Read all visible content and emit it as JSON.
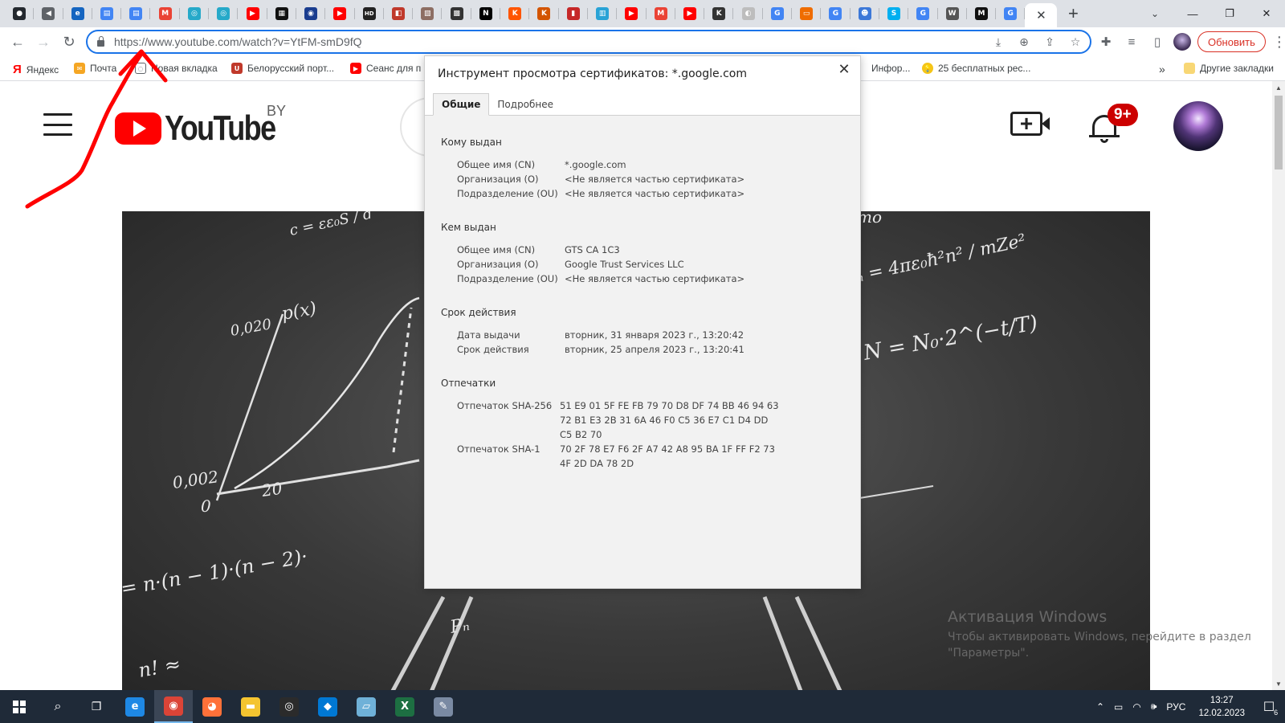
{
  "browser": {
    "tab_favicons": [
      {
        "name": "github-icon",
        "glyph": "●",
        "bg": "#24292f"
      },
      {
        "name": "audio-muted-icon",
        "glyph": "◀",
        "bg": "#5f6368"
      },
      {
        "name": "edge-icon",
        "glyph": "e",
        "bg": "#1565c0"
      },
      {
        "name": "docs-icon",
        "glyph": "▤",
        "bg": "#4285f4"
      },
      {
        "name": "docs-icon",
        "glyph": "▤",
        "bg": "#4285f4"
      },
      {
        "name": "gmail-icon",
        "glyph": "M",
        "bg": "#ea4335"
      },
      {
        "name": "circle-app-icon",
        "glyph": "◎",
        "bg": "#26a9c9"
      },
      {
        "name": "circle-app-icon",
        "glyph": "◎",
        "bg": "#26a9c9"
      },
      {
        "name": "youtube-icon",
        "glyph": "▶",
        "bg": "#ff0000"
      },
      {
        "name": "film-icon",
        "glyph": "▦",
        "bg": "#111111"
      },
      {
        "name": "eye-icon",
        "glyph": "◉",
        "bg": "#1a3d8f"
      },
      {
        "name": "youtube-icon",
        "glyph": "▶",
        "bg": "#ff0000"
      },
      {
        "name": "hd-icon",
        "glyph": "HD",
        "bg": "#222222"
      },
      {
        "name": "bookmark-app-icon",
        "glyph": "◧",
        "bg": "#c0392b"
      },
      {
        "name": "notes-icon",
        "glyph": "▧",
        "bg": "#8d6e63"
      },
      {
        "name": "grid-app-icon",
        "glyph": "▩",
        "bg": "#333333"
      },
      {
        "name": "notion-icon",
        "glyph": "N",
        "bg": "#000000"
      },
      {
        "name": "kinopoisk-icon",
        "glyph": "K",
        "bg": "#ff5500"
      },
      {
        "name": "ki-app-icon",
        "glyph": "K",
        "bg": "#d35400"
      },
      {
        "name": "red-book-icon",
        "glyph": "▮",
        "bg": "#c62828"
      },
      {
        "name": "book-icon",
        "glyph": "▥",
        "bg": "#29a3d6"
      },
      {
        "name": "youtube-icon",
        "glyph": "▶",
        "bg": "#ff0000"
      },
      {
        "name": "gmail-icon",
        "glyph": "M",
        "bg": "#ea4335"
      },
      {
        "name": "youtube-icon",
        "glyph": "▶",
        "bg": "#ff0000"
      },
      {
        "name": "k-app-icon",
        "glyph": "K",
        "bg": "#333333"
      },
      {
        "name": "search-app-icon",
        "glyph": "◐",
        "bg": "#bdbdbd"
      },
      {
        "name": "google-icon",
        "glyph": "G",
        "bg": "#4285f4"
      },
      {
        "name": "web-page-icon",
        "glyph": "▭",
        "bg": "#ef6c00"
      },
      {
        "name": "google-icon",
        "glyph": "G",
        "bg": "#4285f4"
      },
      {
        "name": "reddit-icon",
        "glyph": "☻",
        "bg": "#3c78d8"
      },
      {
        "name": "skype-icon",
        "glyph": "S",
        "bg": "#00aff0"
      },
      {
        "name": "google-icon",
        "glyph": "G",
        "bg": "#4285f4"
      },
      {
        "name": "wikipedia-icon",
        "glyph": "W",
        "bg": "#555555"
      },
      {
        "name": "m-app-icon",
        "glyph": "M",
        "bg": "#111111"
      },
      {
        "name": "google-icon",
        "glyph": "G",
        "bg": "#4285f4"
      }
    ],
    "active_tab_close": "✕",
    "new_tab": "+",
    "url_domain": "https://www.youtube.com",
    "url_path": "/watch?v=YtFM-smD9fQ",
    "update_label": "Обновить"
  },
  "bookmarks": {
    "items": [
      {
        "label": "Яндекс"
      },
      {
        "label": "Почта"
      },
      {
        "label": "Новая вкладка"
      },
      {
        "label": "Белорусский порт..."
      },
      {
        "label": "Сеанс для п"
      },
      {
        "label": "Инфор..."
      },
      {
        "label": "25 бесплатных рес..."
      }
    ],
    "more": "»",
    "other_bookmarks": "Другие закладки"
  },
  "youtube": {
    "logo_text": "YouTube",
    "region": "BY",
    "notification_count": "9+"
  },
  "chalkboard": {
    "formulas": [
      "c = εε₀S / d",
      "0,020",
      "p(x)",
      "0,002",
      "20",
      "0",
      "= n·(n − 1)·(n − 2)·",
      "n! ≈",
      "rₙ = 4πε₀ħ²n² / mZe²",
      "N = N₀·2^(−t/T)",
      "Pₙ",
      "mo"
    ]
  },
  "certificate": {
    "title": "Инструмент просмотра сертификатов: *.google.com",
    "close": "✕",
    "tabs": [
      {
        "label": "Общие",
        "active": true
      },
      {
        "label": "Подробнее",
        "active": false
      }
    ],
    "issued_to": {
      "heading": "Кому выдан",
      "rows": [
        {
          "key": "Общее имя (CN)",
          "value": "*.google.com"
        },
        {
          "key": "Организация (O)",
          "value": "<Не является частью сертификата>"
        },
        {
          "key": "Подразделение (OU)",
          "value": "<Не является частью сертификата>"
        }
      ]
    },
    "issued_by": {
      "heading": "Кем выдан",
      "rows": [
        {
          "key": "Общее имя (CN)",
          "value": "GTS CA 1C3"
        },
        {
          "key": "Организация (O)",
          "value": "Google Trust Services LLC"
        },
        {
          "key": "Подразделение (OU)",
          "value": "<Не является частью сертификата>"
        }
      ]
    },
    "validity": {
      "heading": "Срок действия",
      "rows": [
        {
          "key": "Дата выдачи",
          "value": "вторник, 31 января 2023 г., 13:20:42"
        },
        {
          "key": "Срок действия",
          "value": "вторник, 25 апреля 2023 г., 13:20:41"
        }
      ]
    },
    "fingerprints": {
      "heading": "Отпечатки",
      "rows": [
        {
          "key": "Отпечаток SHA-256",
          "value": "51 E9 01 5F FE FB 79 70 D8 DF 74 BB 46 94 63 72 B1 E3 2B 31 6A 46 F0 C5 36 E7 C1 D4 DD C5 B2 70"
        },
        {
          "key": "Отпечаток SHA-1",
          "value": "70 2F 78 E7 F6 2F A7 42 A8 95 BA 1F FF F2 73 4F 2D DA 78 2D"
        }
      ]
    }
  },
  "watermark": {
    "title": "Активация Windows",
    "line1": "Чтобы активировать Windows, перейдите в раздел",
    "line2": "\"Параметры\"."
  },
  "taskbar": {
    "apps": [
      {
        "name": "ie-icon",
        "glyph": "e",
        "bg": "#1e88e5"
      },
      {
        "name": "chrome-icon",
        "glyph": "◉",
        "bg": "#db4437",
        "active": true
      },
      {
        "name": "firefox-icon",
        "glyph": "◕",
        "bg": "#ff7139"
      },
      {
        "name": "file-explorer-icon",
        "glyph": "▬",
        "bg": "#f4c430"
      },
      {
        "name": "obs-icon",
        "glyph": "◎",
        "bg": "#2b2b2b"
      },
      {
        "name": "vscode-icon",
        "glyph": "◆",
        "bg": "#0078d4"
      },
      {
        "name": "notepad-icon",
        "glyph": "▱",
        "bg": "#6fb1d8"
      },
      {
        "name": "excel-icon",
        "glyph": "X",
        "bg": "#1d6f42"
      },
      {
        "name": "paint-icon",
        "glyph": "✎",
        "bg": "#7a8aa3"
      }
    ],
    "language": "РУС",
    "time": "13:27",
    "date": "12.02.2023",
    "notification_count": "6"
  },
  "colors": {
    "accent": "#1a73e8",
    "annotation": "#ff0000",
    "update": "#d93025",
    "youtube_red": "#ff0000"
  }
}
